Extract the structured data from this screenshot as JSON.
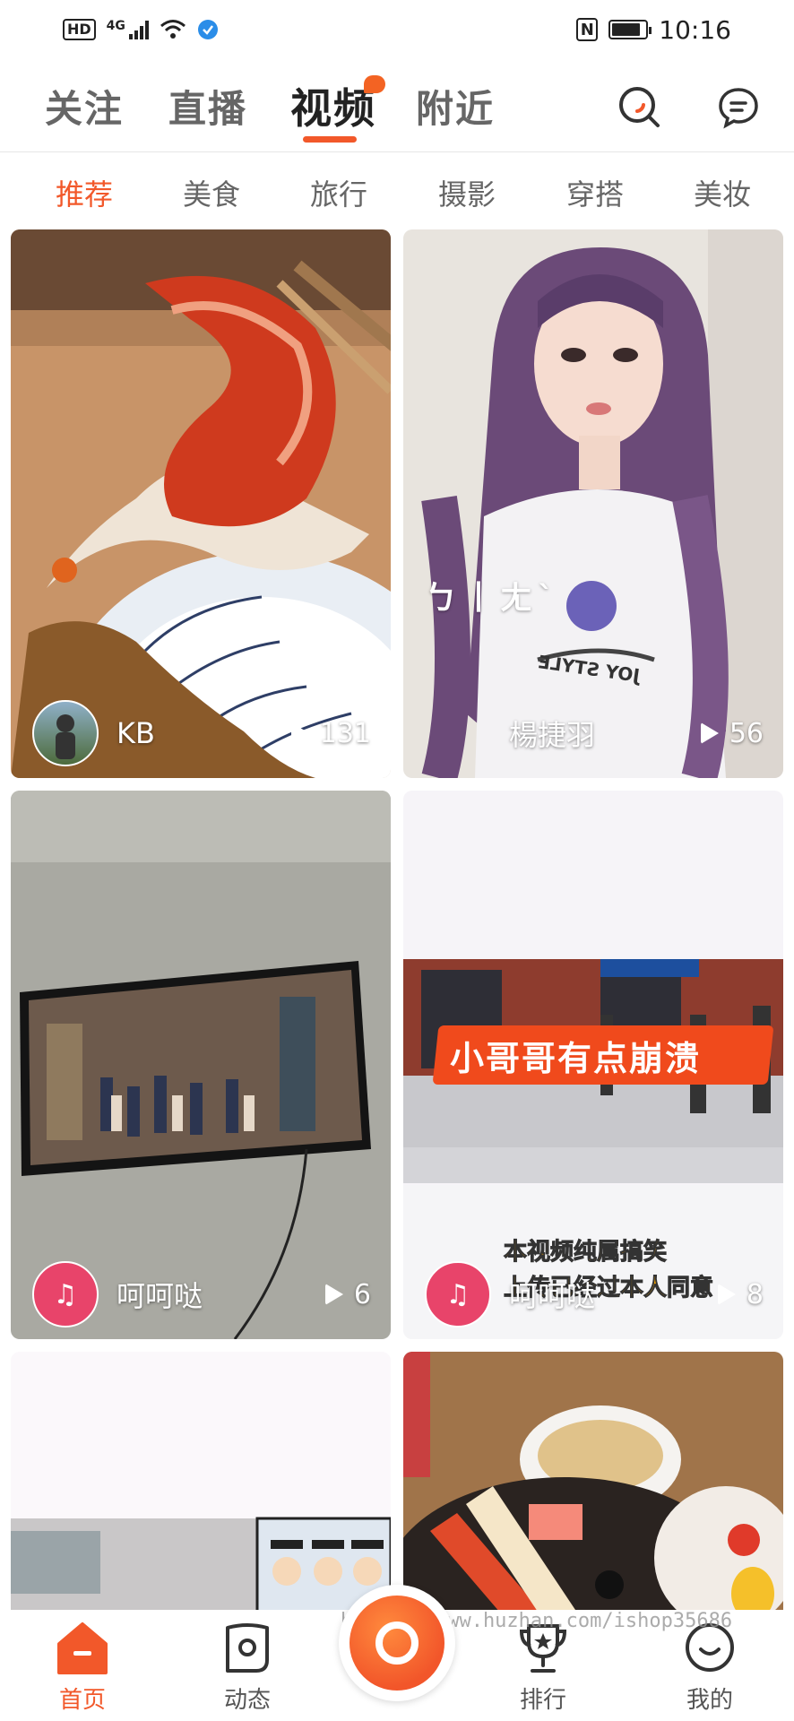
{
  "status": {
    "hd": "HD",
    "network": "4G",
    "nfc": "N",
    "battery_level": 0.85,
    "time": "10:16"
  },
  "top_tabs": [
    {
      "label": "关注",
      "active": false
    },
    {
      "label": "直播",
      "active": false
    },
    {
      "label": "视频",
      "active": true,
      "badge_dot": true
    },
    {
      "label": "附近",
      "active": false
    }
  ],
  "top_icons": [
    "search-icon",
    "message-icon"
  ],
  "categories": [
    {
      "label": "推荐",
      "active": true
    },
    {
      "label": "美食",
      "active": false
    },
    {
      "label": "旅行",
      "active": false
    },
    {
      "label": "摄影",
      "active": false
    },
    {
      "label": "穿搭",
      "active": false
    },
    {
      "label": "美妆",
      "active": false
    }
  ],
  "videos": [
    {
      "author": "KB",
      "plays": "131",
      "avatar_icon": "person-avatar-icon"
    },
    {
      "author": "楊捷羽",
      "plays": "56",
      "overlay": "ㄅ丨ㄤˋ",
      "shirt_text": "JOY STYLE"
    },
    {
      "author": "呵呵哒",
      "plays": "6",
      "avatar_icon": "live-avatar-icon"
    },
    {
      "author": "呵呵哒",
      "plays": "8",
      "avatar_icon": "live-avatar-icon",
      "banner": "小哥哥有点崩溃",
      "caption_1": "本视频纯属搞笑",
      "caption_2": "上传已经过本人同意"
    },
    {
      "author": "",
      "plays": ""
    },
    {
      "author": "",
      "plays": ""
    }
  ],
  "bottom_nav": [
    {
      "label": "首页",
      "icon": "home-icon",
      "active": true
    },
    {
      "label": "动态",
      "icon": "feed-icon",
      "active": false
    },
    {
      "label": "",
      "icon": "record-icon",
      "active": false
    },
    {
      "label": "排行",
      "icon": "trophy-icon",
      "active": false
    },
    {
      "label": "我的",
      "icon": "profile-icon",
      "active": false
    }
  ],
  "watermark": "https://www.huzhan.com/ishop35686",
  "colors": {
    "accent": "#f2582a",
    "text_dark": "#222222",
    "text_muted": "#666666"
  }
}
